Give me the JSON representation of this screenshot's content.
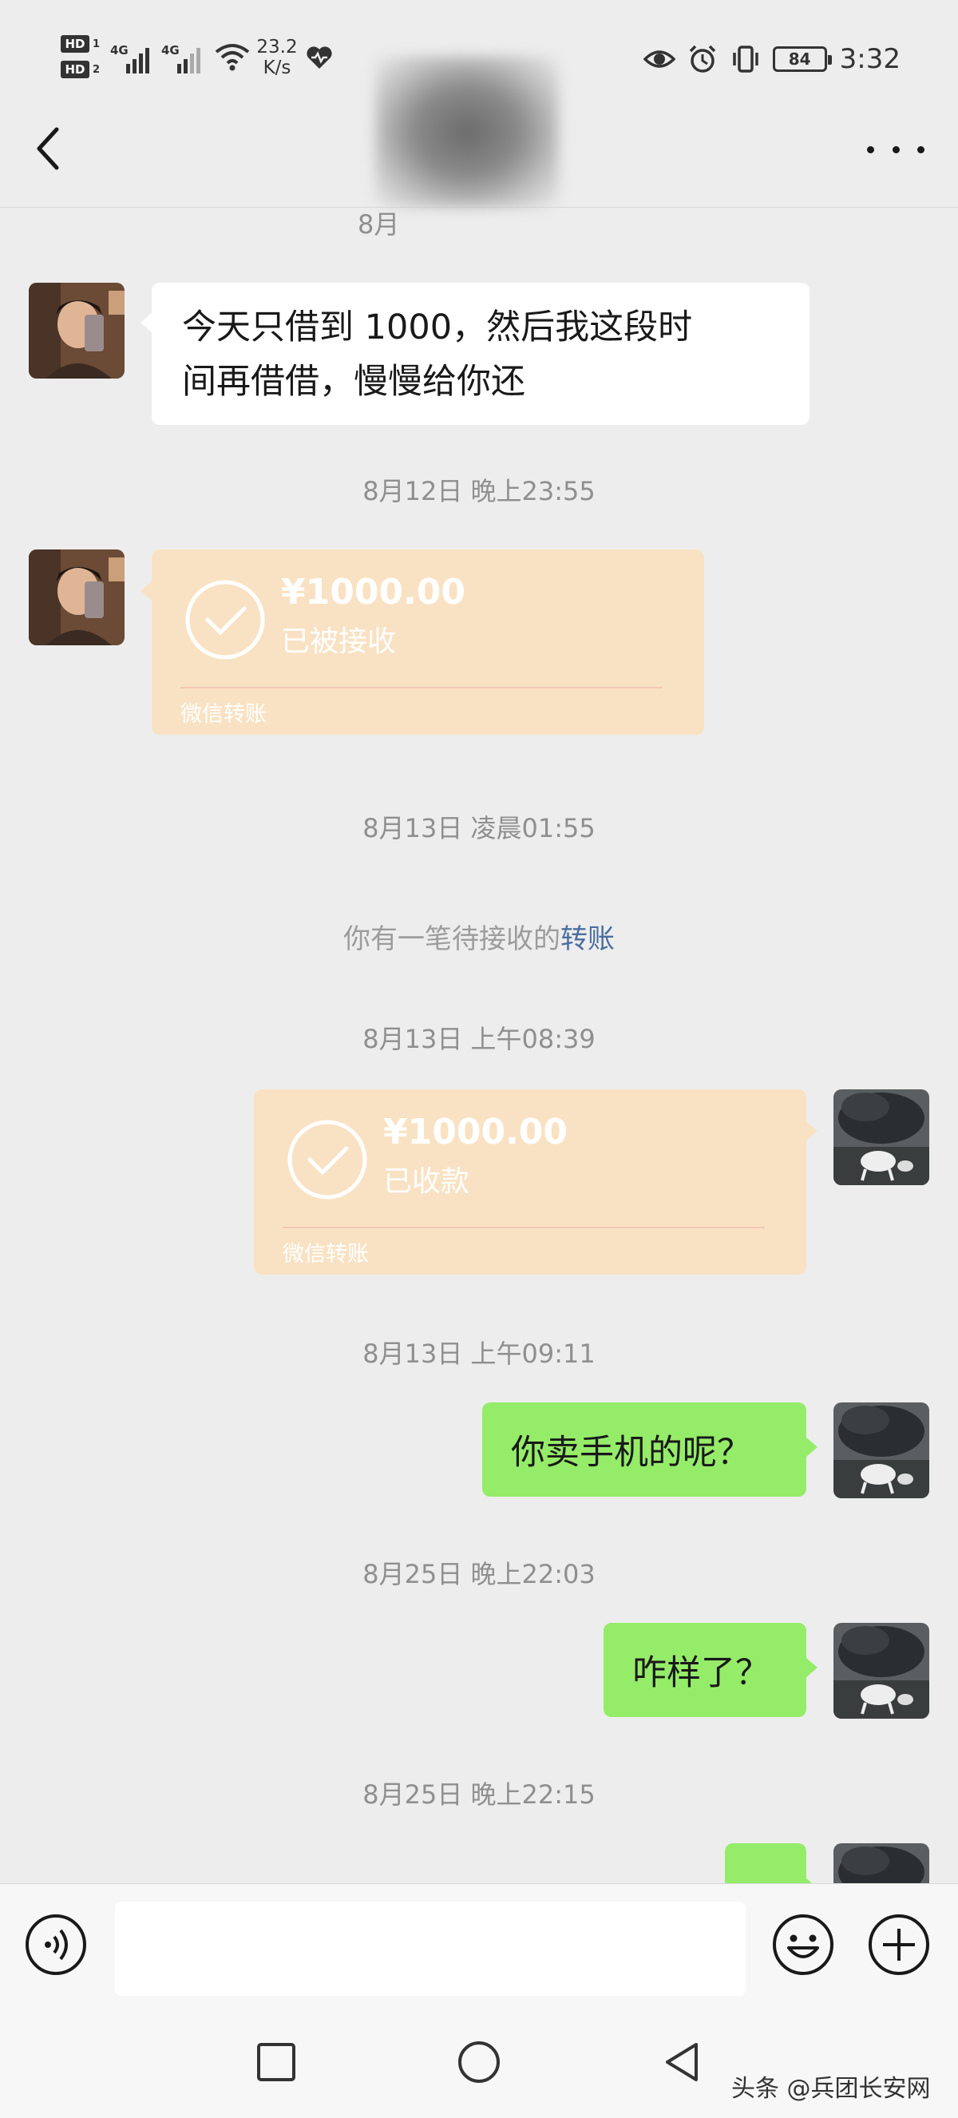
{
  "status_bar": {
    "hd1": "HD",
    "hd1_sub": "1",
    "hd2": "HD",
    "hd2_sub": "2",
    "net1": "4G",
    "net2": "4G",
    "speed_value": "23.2",
    "speed_unit": "K/s",
    "battery": "84",
    "time": "3:32"
  },
  "nav": {
    "back_icon": "chevron-left-icon",
    "more_icon": "more-dots-icon"
  },
  "messages": {
    "partial_ts": "8月",
    "msg1_line1": "今天只借到 1000，然后我这段时",
    "msg1_line2": "间再借借，慢慢给你还",
    "ts1": "8月12日 晚上23:55",
    "transfer1": {
      "amount": "¥1000.00",
      "state": "已被接收",
      "footer": "微信转账"
    },
    "ts2": "8月13日 凌晨01:55",
    "system_text": "你有一笔待接收的",
    "system_link": "转账",
    "ts3": "8月13日 上午08:39",
    "transfer2": {
      "amount": "¥1000.00",
      "state": "已收款",
      "footer": "微信转账"
    },
    "ts4": "8月13日 上午09:11",
    "msg2": "你卖手机的呢？",
    "ts5": "8月25日 晚上22:03",
    "msg3": "咋样了？",
    "ts6": "8月25日 晚上22:15"
  },
  "input_bar": {
    "voice_icon": "voice-icon",
    "emoji_icon": "emoji-icon",
    "plus_icon": "plus-icon",
    "input_value": ""
  },
  "system_nav": {
    "watermark": "头条 @兵团长安网"
  },
  "colors": {
    "background": "#ededed",
    "bubble_green": "#95ec69",
    "transfer_bg": "#f9e2c3",
    "link": "#4a6ea0"
  }
}
